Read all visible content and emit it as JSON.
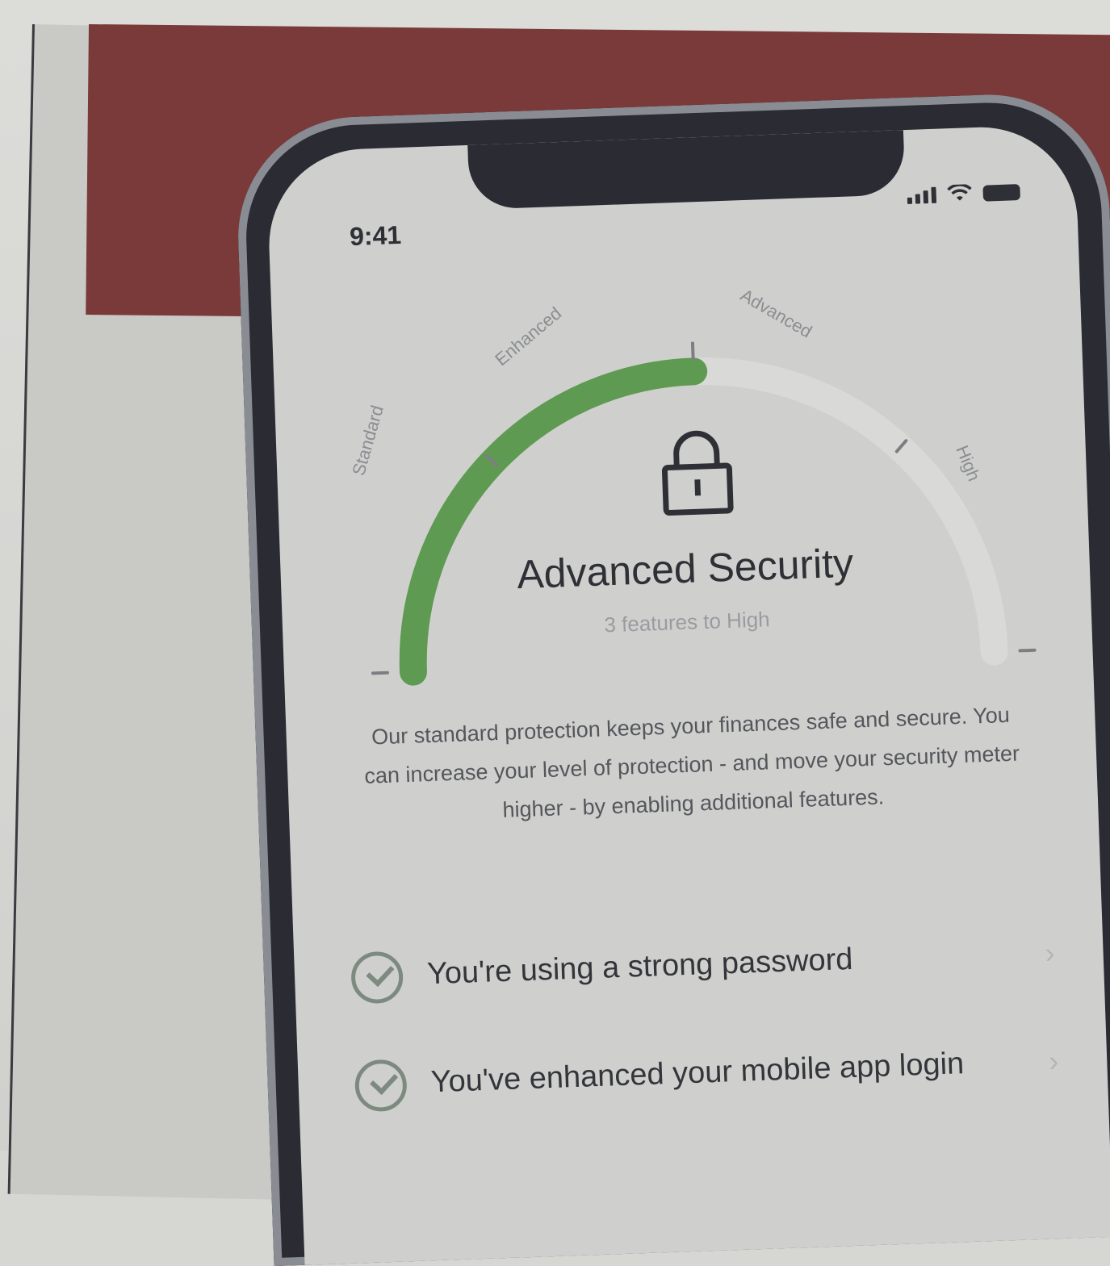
{
  "status_bar": {
    "time": "9:41"
  },
  "gauge": {
    "labels": [
      "Standard",
      "Enhanced",
      "Advanced",
      "High"
    ],
    "level_fraction": 0.5,
    "accent": "#5e9a52"
  },
  "security": {
    "title": "Advanced Security",
    "subtitle": "3 features to High",
    "description": "Our standard protection keeps your finances safe and secure. You can increase your level of protection - and move your security meter higher - by enabling additional features."
  },
  "features": [
    {
      "label": "You're using a strong password",
      "icon": "check-circle-icon"
    },
    {
      "label": "You've enhanced your mobile app login",
      "icon": "check-circle-icon"
    }
  ]
}
